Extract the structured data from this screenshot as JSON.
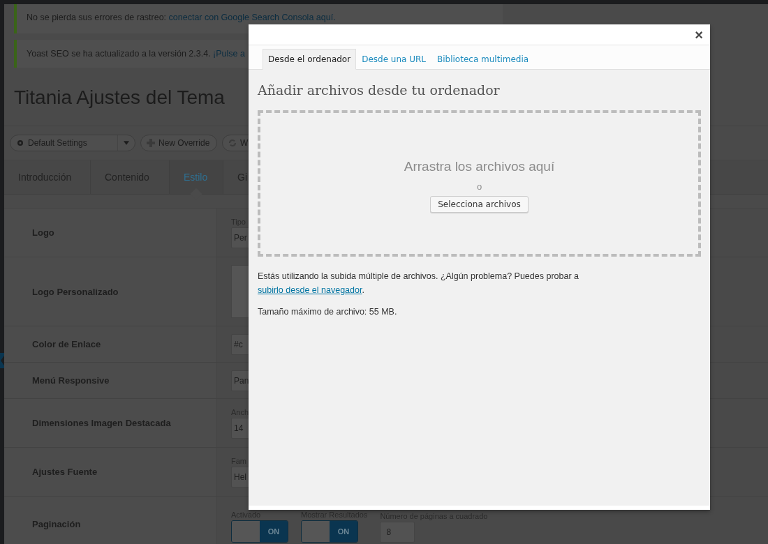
{
  "notices": [
    {
      "text": "No se pierda sus errores de rastreo: ",
      "link": "conectar con Google Search Consola aquí."
    },
    {
      "text": "Yoast SEO se ha actualizado a la versión 2.3.4. ",
      "link": "¡Pulse a"
    }
  ],
  "page_title": "Titania Ajustes del Tema",
  "toolbar": [
    {
      "kind": "dropdown",
      "label": "Default Settings"
    },
    {
      "kind": "add",
      "label": "New Override"
    },
    {
      "kind": "refresh",
      "label": "W"
    }
  ],
  "tabs": [
    {
      "label": "Introducción",
      "selected": false
    },
    {
      "label": "Contenido",
      "selected": false
    },
    {
      "label": "Estilo",
      "selected": true
    },
    {
      "label": "Gi",
      "selected": false
    }
  ],
  "settings": [
    {
      "label": "Logo",
      "kind": "select",
      "caption": "Tipo",
      "value": "Per"
    },
    {
      "label": "Logo Personalizado",
      "kind": "image"
    },
    {
      "label": "Color de Enlace",
      "kind": "input",
      "value": "#c"
    },
    {
      "label": "Menú Responsive",
      "kind": "select",
      "value": "Pan"
    },
    {
      "label": "Dimensiones Imagen Destacada",
      "kind": "input",
      "caption": "Anch",
      "value": "14"
    },
    {
      "label": "Ajustes Fuente",
      "kind": "select",
      "caption": "Fam",
      "value": "Hel"
    },
    {
      "label": "Paginación",
      "kind": "controls",
      "controls": [
        {
          "kind": "toggle",
          "caption": "Activado",
          "on": true,
          "text": "ON"
        },
        {
          "kind": "toggle",
          "caption": "Mostrar Resultados",
          "on": true,
          "text": "ON"
        },
        {
          "kind": "number",
          "caption": "Número de páginas a cuadrado",
          "value": "8"
        }
      ]
    }
  ],
  "modal": {
    "close": "×",
    "tabs": [
      {
        "label": "Desde el ordenador",
        "selected": true
      },
      {
        "label": "Desde una URL",
        "selected": false
      },
      {
        "label": "Biblioteca multimedia",
        "selected": false
      }
    ],
    "heading": "Añadir archivos desde tu ordenador",
    "drop_text": "Arrastra los archivos aquí",
    "or_text": "o",
    "select_button": "Selecciona archivos",
    "note": {
      "text": "Estás utilizando la subida múltiple de archivos. ¿Algún problema? Puedes probar a ",
      "link": "subirlo desde el navegador",
      "after": "."
    },
    "max_size": "Tamaño máximo de archivo: 55 MB."
  }
}
